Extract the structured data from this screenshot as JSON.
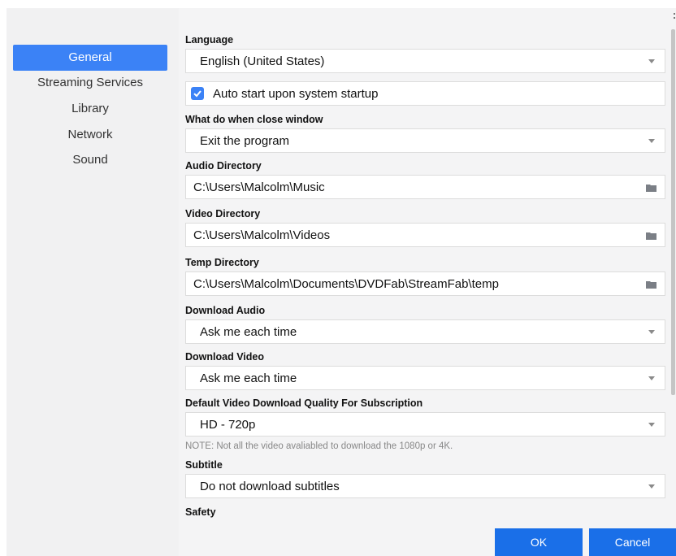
{
  "sidebar": {
    "items": [
      {
        "label": "General",
        "active": true
      },
      {
        "label": "Streaming Services",
        "active": false
      },
      {
        "label": "Library",
        "active": false
      },
      {
        "label": "Network",
        "active": false
      },
      {
        "label": "Sound",
        "active": false
      }
    ]
  },
  "settings": {
    "language": {
      "label": "Language",
      "value": "English (United States)"
    },
    "autostart": {
      "label": "Auto start upon system startup",
      "checked": true
    },
    "close_window": {
      "label": "What do when close window",
      "value": "Exit the program"
    },
    "audio_dir": {
      "label": "Audio Directory",
      "value": "C:\\Users\\Malcolm\\Music"
    },
    "video_dir": {
      "label": "Video Directory",
      "value": "C:\\Users\\Malcolm\\Videos"
    },
    "temp_dir": {
      "label": "Temp Directory",
      "value": "C:\\Users\\Malcolm\\Documents\\DVDFab\\StreamFab\\temp"
    },
    "download_audio": {
      "label": "Download Audio",
      "value": "Ask me each time"
    },
    "download_video": {
      "label": "Download Video",
      "value": "Ask me each time"
    },
    "quality": {
      "label": "Default Video Download Quality For Subscription",
      "value": "HD - 720p"
    },
    "note": "NOTE: Not all the video avaliabled to download the 1080p or 4K.",
    "subtitle": {
      "label": "Subtitle",
      "value": "Do not download subtitles"
    },
    "safety": {
      "label": "Safety"
    }
  },
  "buttons": {
    "ok": "OK",
    "cancel": "Cancel"
  },
  "colors": {
    "accent": "#3b82f6",
    "button": "#1a6fe8"
  }
}
